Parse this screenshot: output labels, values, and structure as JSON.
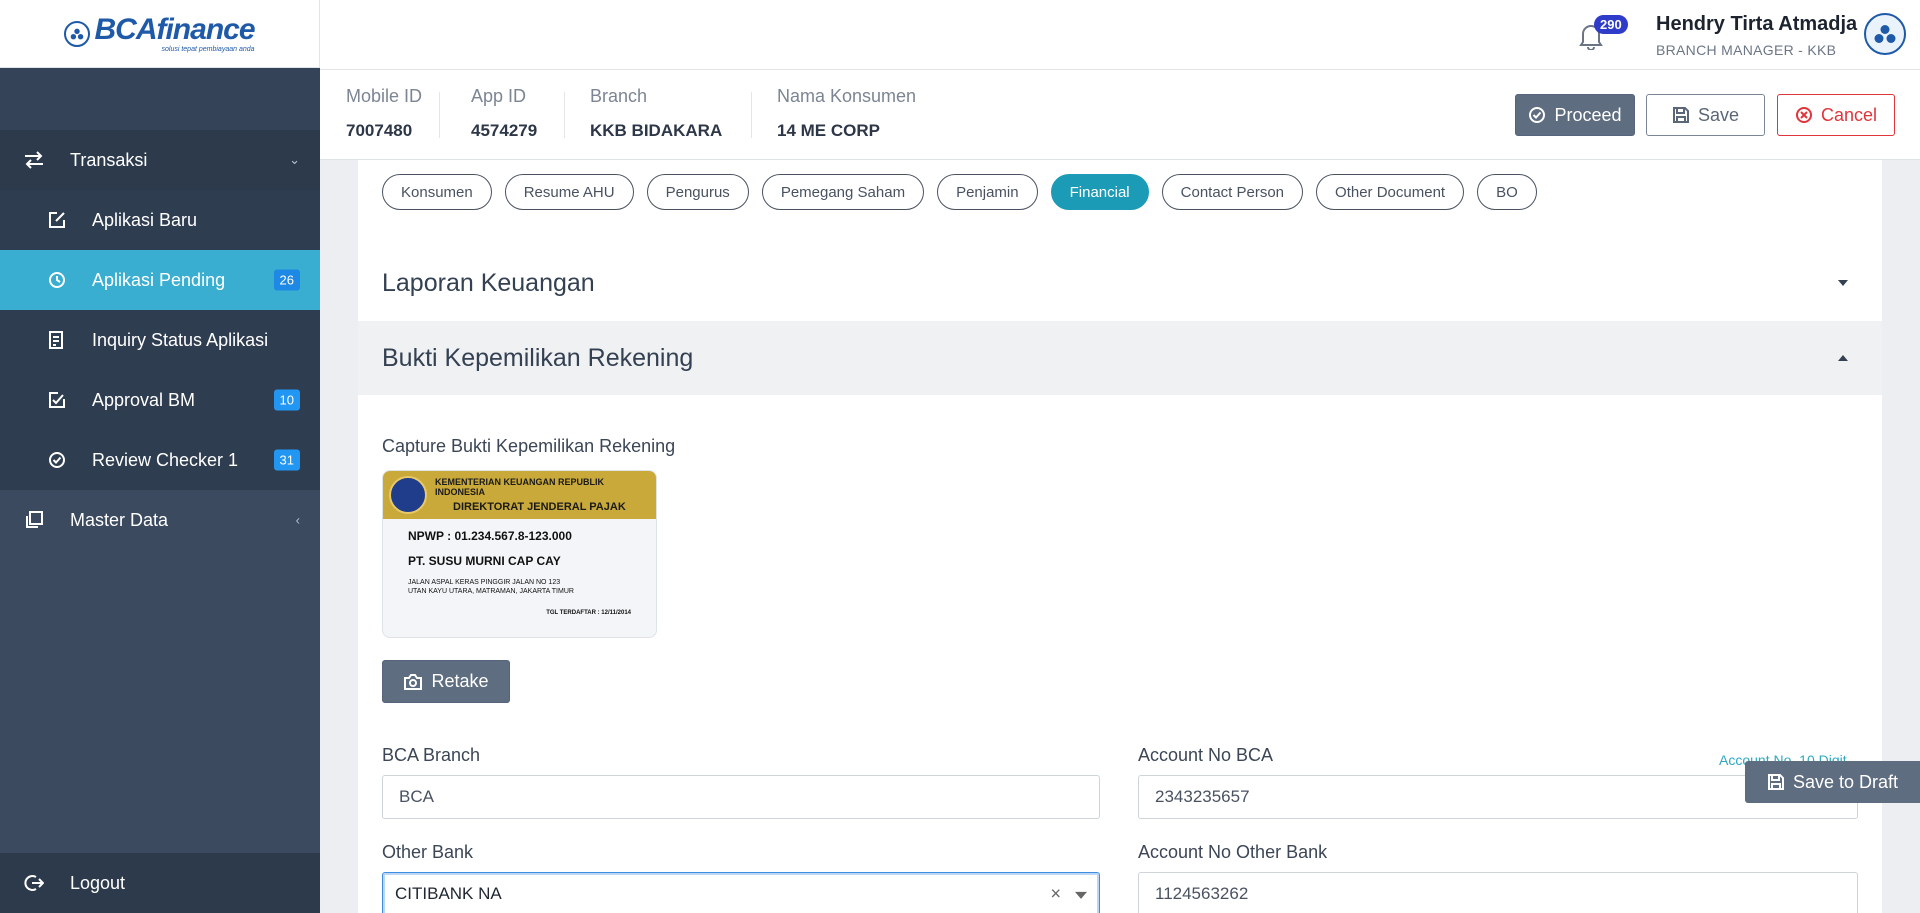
{
  "brand": {
    "name": "BCAfinance",
    "tagline": "solusi tepat pembiayaan anda"
  },
  "sidebar": {
    "groups": [
      {
        "label": "Transaksi",
        "icon": "swap-icon"
      },
      {
        "label": "Master Data",
        "icon": "copy-icon"
      }
    ],
    "items": [
      {
        "label": "Aplikasi Baru",
        "icon": "edit-icon",
        "badge": ""
      },
      {
        "label": "Aplikasi Pending",
        "icon": "clock-icon",
        "badge": "26"
      },
      {
        "label": "Inquiry Status Aplikasi",
        "icon": "document-icon",
        "badge": ""
      },
      {
        "label": "Approval BM",
        "icon": "approval-icon",
        "badge": "10"
      },
      {
        "label": "Review Checker 1",
        "icon": "check-circle-icon",
        "badge": "31"
      }
    ],
    "logout": "Logout"
  },
  "header": {
    "notification_count": "290",
    "user_name": "Hendry Tirta Atmadja",
    "user_role": "BRANCH MANAGER - KKB"
  },
  "info": {
    "mobile_id_label": "Mobile ID",
    "mobile_id": "7007480",
    "app_id_label": "App ID",
    "app_id": "4574279",
    "branch_label": "Branch",
    "branch": "KKB BIDAKARA",
    "nama_label": "Nama Konsumen",
    "nama": "14 ME CORP"
  },
  "actions": {
    "proceed": "Proceed",
    "save": "Save",
    "cancel": "Cancel"
  },
  "tabs": [
    "Konsumen",
    "Resume AHU",
    "Pengurus",
    "Pemegang Saham",
    "Penjamin",
    "Financial",
    "Contact Person",
    "Other Document",
    "BO"
  ],
  "active_tab": "Financial",
  "sections": {
    "laporan": "Laporan Keuangan",
    "bukti": "Bukti Kepemilikan Rekening"
  },
  "capture": {
    "label": "Capture Bukti Kepemilikan Rekening",
    "card": {
      "header1": "KEMENTERIAN KEUANGAN REPUBLIK INDONESIA",
      "header2": "DIREKTORAT JENDERAL PAJAK",
      "npwp": "NPWP :  01.234.567.8-123.000",
      "name": "PT. SUSU MURNI CAP CAY",
      "addr1": "JALAN ASPAL KERAS PINGGIR JALAN NO 123",
      "addr2": "UTAN KAYU UTARA, MATRAMAN, JAKARTA TIMUR",
      "date": "TGL TERDAFTAR :  12/11/2014"
    },
    "retake": "Retake"
  },
  "form": {
    "bca_branch_label": "BCA Branch",
    "bca_branch_value": "BCA",
    "account_bca_label": "Account No BCA",
    "account_bca_hint": "Account No. 10 Digit",
    "account_bca_value": "2343235657",
    "other_bank_label": "Other Bank",
    "other_bank_value": "CITIBANK NA",
    "account_other_label": "Account No Other Bank",
    "account_other_value": "1124563262"
  },
  "draft": "Save to Draft",
  "colors": {
    "accent": "#1c9bb6",
    "sidebar": "#3b4a5e",
    "active": "#3aaed0",
    "danger": "#e0353b"
  }
}
